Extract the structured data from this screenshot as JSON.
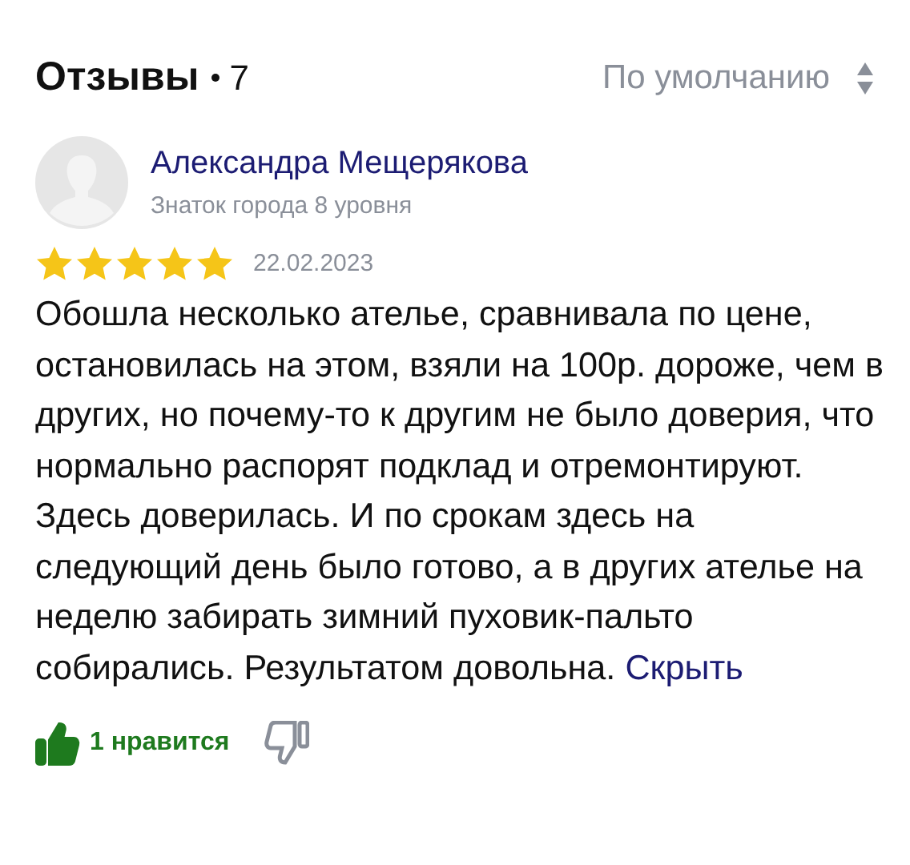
{
  "header": {
    "title": "Отзывы",
    "count": "7",
    "sort": "По умолчанию"
  },
  "review": {
    "author": "Александра Мещерякова",
    "level": "Знаток города 8 уровня",
    "stars": 5,
    "date": "22.02.2023",
    "text": "Обошла несколько ателье, сравнивала по цене, остановилась на этом, взяли на 100р. дороже, чем в других, но почему-то к другим не было доверия, что нормально распорят подклад и отремонтируют. Здесь доверилась. И по срокам здесь на следующий день было готово, а в других ателье на неделю забирать зимний пуховик-пальто собирались. Результатом довольна.",
    "hide_link": "Скрыть",
    "likes": {
      "label": "1 нравится",
      "liked": true
    },
    "dislike": {
      "disliked": false
    }
  }
}
